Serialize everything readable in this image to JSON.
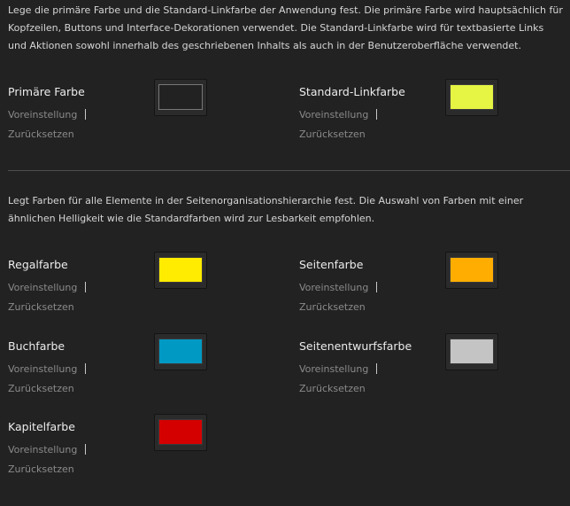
{
  "intro": {
    "text": "Lege die primäre Farbe und die Standard-Linkfarbe der Anwendung fest. Die primäre Farbe wird hauptsächlich für Kopfzeilen, Buttons und Interface-Dekorationen verwendet. Die Standard-Linkfarbe wird für textbasierte Links und Aktionen sowohl innerhalb des geschriebenen Inhalts als auch in der Benutzeroberfläche verwendet."
  },
  "hierarchy": {
    "text": "Legt Farben für alle Elemente in der Seitenorganisationshierarchie fest. Die Auswahl von Farben mit einer ähnlichen Helligkeit wie die Standardfarben wird zur Lesbarkeit empfohlen."
  },
  "actions": {
    "default_label": "Voreinstellung",
    "reset_label": "Zurücksetzen"
  },
  "settings": {
    "primary": {
      "label": "Primäre Farbe",
      "color": "#222222"
    },
    "link": {
      "label": "Standard-Linkfarbe",
      "color": "#e6f443"
    },
    "shelf": {
      "label": "Regalfarbe",
      "color": "#ffec00"
    },
    "page": {
      "label": "Seitenfarbe",
      "color": "#ffad00"
    },
    "book": {
      "label": "Buchfarbe",
      "color": "#0099c4"
    },
    "draft": {
      "label": "Seitenentwurfsfarbe",
      "color": "#c4c4c4"
    },
    "chapter": {
      "label": "Kapitelfarbe",
      "color": "#d40000"
    }
  }
}
